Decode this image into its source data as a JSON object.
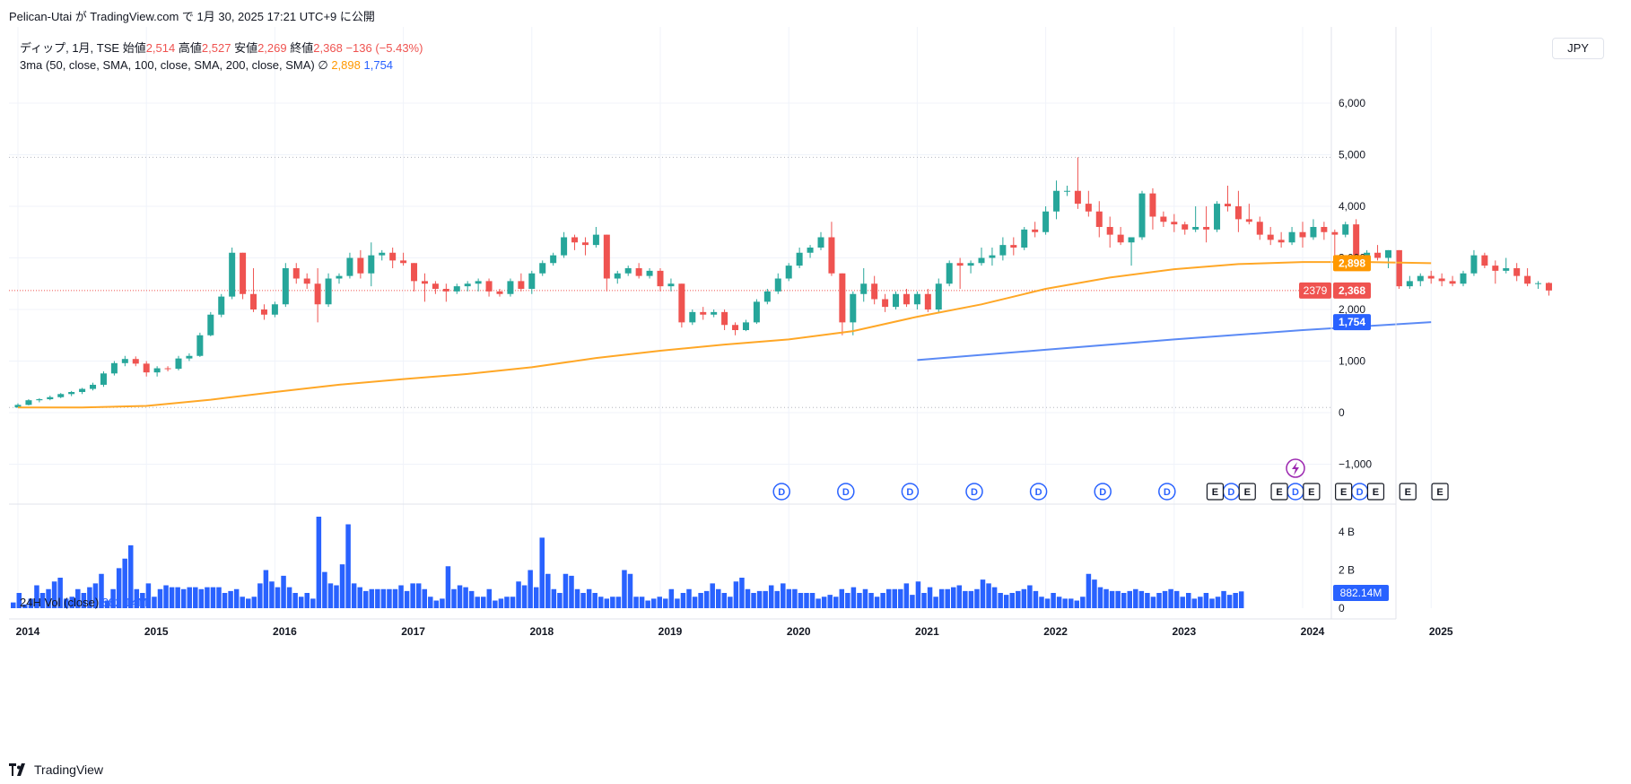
{
  "header": {
    "publish_line": "Pelican-Utai が TradingView.com で 1月 30, 2025 17:21 UTC+9 に公開"
  },
  "legend": {
    "symbol": "ディップ, 1月, TSE",
    "open_label": "始値",
    "open": "2,514",
    "high_label": "高値",
    "high": "2,527",
    "low_label": "安値",
    "low": "2,269",
    "close_label": "終値",
    "close": "2,368",
    "change": "−136 (−5.43%)",
    "ma_label": "3ma (50, close, SMA, 100, close, SMA, 200, close, SMA)",
    "ma_empty": "∅",
    "ma50": "2,898",
    "ma100": "1,754",
    "vol_label": "24H Vol (close)",
    "vol_value": "882.14M"
  },
  "currency": "JPY",
  "footer": {
    "brand": "TradingView"
  },
  "colors": {
    "up": "#26a69a",
    "down": "#ef5350",
    "ma50": "#ffa726",
    "ma100": "#5b8af5",
    "volume": "#2962ff"
  },
  "chart_data": {
    "type": "candlestick",
    "interval": "monthly",
    "start": "2014-01",
    "ohlc": [
      [
        100,
        180,
        95,
        150
      ],
      [
        150,
        260,
        140,
        240
      ],
      [
        240,
        280,
        200,
        260
      ],
      [
        260,
        330,
        240,
        300
      ],
      [
        300,
        380,
        280,
        360
      ],
      [
        360,
        420,
        320,
        400
      ],
      [
        400,
        480,
        360,
        460
      ],
      [
        460,
        580,
        430,
        540
      ],
      [
        540,
        800,
        500,
        760
      ],
      [
        760,
        1000,
        720,
        960
      ],
      [
        960,
        1100,
        900,
        1040
      ],
      [
        1040,
        1090,
        900,
        950
      ],
      [
        950,
        1000,
        700,
        780
      ],
      [
        780,
        900,
        700,
        860
      ],
      [
        860,
        900,
        800,
        850
      ],
      [
        850,
        1100,
        820,
        1050
      ],
      [
        1050,
        1150,
        1000,
        1100
      ],
      [
        1100,
        1550,
        1080,
        1500
      ],
      [
        1500,
        1950,
        1480,
        1900
      ],
      [
        1900,
        2300,
        1850,
        2250
      ],
      [
        2250,
        3200,
        2200,
        3100
      ],
      [
        3100,
        3100,
        2200,
        2300
      ],
      [
        2300,
        2800,
        1950,
        2000
      ],
      [
        2000,
        2100,
        1800,
        1900
      ],
      [
        1900,
        2150,
        1850,
        2100
      ],
      [
        2100,
        2900,
        2050,
        2800
      ],
      [
        2800,
        2900,
        2500,
        2600
      ],
      [
        2600,
        2700,
        2400,
        2500
      ],
      [
        2500,
        2800,
        1750,
        2100
      ],
      [
        2100,
        2700,
        2050,
        2600
      ],
      [
        2600,
        2700,
        2500,
        2650
      ],
      [
        2650,
        3100,
        2600,
        3000
      ],
      [
        3000,
        3150,
        2600,
        2700
      ],
      [
        2700,
        3300,
        2450,
        3050
      ],
      [
        3050,
        3150,
        2950,
        3100
      ],
      [
        3100,
        3200,
        2800,
        2950
      ],
      [
        2950,
        3100,
        2850,
        2900
      ],
      [
        2900,
        2900,
        2350,
        2550
      ],
      [
        2550,
        2700,
        2150,
        2500
      ],
      [
        2500,
        2550,
        2300,
        2400
      ],
      [
        2400,
        2500,
        2150,
        2350
      ],
      [
        2350,
        2500,
        2300,
        2450
      ],
      [
        2450,
        2550,
        2350,
        2500
      ],
      [
        2500,
        2600,
        2350,
        2550
      ],
      [
        2550,
        2600,
        2250,
        2350
      ],
      [
        2350,
        2400,
        2250,
        2300
      ],
      [
        2300,
        2600,
        2250,
        2550
      ],
      [
        2550,
        2700,
        2350,
        2400
      ],
      [
        2400,
        2750,
        2300,
        2700
      ],
      [
        2700,
        2950,
        2650,
        2900
      ],
      [
        2900,
        3100,
        2850,
        3050
      ],
      [
        3050,
        3500,
        3000,
        3400
      ],
      [
        3400,
        3450,
        3150,
        3300
      ],
      [
        3300,
        3400,
        3050,
        3250
      ],
      [
        3250,
        3600,
        3200,
        3450
      ],
      [
        3450,
        3450,
        2350,
        2600
      ],
      [
        2600,
        2750,
        2500,
        2700
      ],
      [
        2700,
        2850,
        2650,
        2800
      ],
      [
        2800,
        2900,
        2600,
        2650
      ],
      [
        2650,
        2800,
        2600,
        2750
      ],
      [
        2750,
        2800,
        2350,
        2450
      ],
      [
        2450,
        2600,
        2350,
        2500
      ],
      [
        2500,
        2500,
        1650,
        1750
      ],
      [
        1750,
        2000,
        1700,
        1950
      ],
      [
        1950,
        2050,
        1800,
        1900
      ],
      [
        1900,
        2000,
        1850,
        1950
      ],
      [
        1950,
        2000,
        1600,
        1700
      ],
      [
        1700,
        1750,
        1500,
        1600
      ],
      [
        1600,
        1800,
        1580,
        1750
      ],
      [
        1750,
        2200,
        1720,
        2150
      ],
      [
        2150,
        2400,
        2100,
        2350
      ],
      [
        2350,
        2700,
        2300,
        2600
      ],
      [
        2600,
        2900,
        2550,
        2850
      ],
      [
        2850,
        3200,
        2800,
        3100
      ],
      [
        3100,
        3250,
        3000,
        3200
      ],
      [
        3200,
        3500,
        3150,
        3400
      ],
      [
        3400,
        3700,
        2650,
        2700
      ],
      [
        2700,
        2700,
        1500,
        1750
      ],
      [
        1750,
        2350,
        1500,
        2300
      ],
      [
        2300,
        2800,
        2150,
        2500
      ],
      [
        2500,
        2650,
        2100,
        2200
      ],
      [
        2200,
        2300,
        1950,
        2050
      ],
      [
        2050,
        2350,
        2000,
        2300
      ],
      [
        2300,
        2400,
        2050,
        2100
      ],
      [
        2100,
        2350,
        2000,
        2300
      ],
      [
        2300,
        2400,
        1950,
        2000
      ],
      [
        2000,
        2600,
        1950,
        2500
      ],
      [
        2500,
        2950,
        2450,
        2900
      ],
      [
        2900,
        3000,
        2400,
        2850
      ],
      [
        2850,
        2950,
        2700,
        2900
      ],
      [
        2900,
        3200,
        2850,
        3000
      ],
      [
        3000,
        3200,
        2850,
        3050
      ],
      [
        3050,
        3400,
        2950,
        3250
      ],
      [
        3250,
        3400,
        3050,
        3200
      ],
      [
        3200,
        3600,
        3150,
        3550
      ],
      [
        3550,
        3700,
        3400,
        3500
      ],
      [
        3500,
        4000,
        3450,
        3900
      ],
      [
        3900,
        4500,
        3750,
        4300
      ],
      [
        4300,
        4400,
        4200,
        4300
      ],
      [
        4300,
        4950,
        3950,
        4050
      ],
      [
        4050,
        4300,
        3800,
        3900
      ],
      [
        3900,
        4100,
        3400,
        3600
      ],
      [
        3600,
        3800,
        3200,
        3450
      ],
      [
        3450,
        3600,
        3250,
        3300
      ],
      [
        3300,
        3400,
        2850,
        3400
      ],
      [
        3400,
        4300,
        3350,
        4250
      ],
      [
        4250,
        4350,
        3550,
        3800
      ],
      [
        3800,
        3900,
        3600,
        3700
      ],
      [
        3700,
        3850,
        3500,
        3650
      ],
      [
        3650,
        3700,
        3450,
        3550
      ],
      [
        3550,
        4000,
        3500,
        3600
      ],
      [
        3600,
        4000,
        3300,
        3550
      ],
      [
        3550,
        4100,
        3500,
        4050
      ],
      [
        4050,
        4400,
        3900,
        4000
      ],
      [
        4000,
        4300,
        3500,
        3750
      ],
      [
        3750,
        4050,
        3650,
        3700
      ],
      [
        3700,
        3800,
        3350,
        3450
      ],
      [
        3450,
        3600,
        3250,
        3350
      ],
      [
        3350,
        3500,
        3200,
        3300
      ],
      [
        3300,
        3600,
        3250,
        3500
      ],
      [
        3500,
        3700,
        3200,
        3400
      ],
      [
        3400,
        3750,
        3350,
        3600
      ],
      [
        3600,
        3700,
        3350,
        3500
      ],
      [
        3500,
        3550,
        3050,
        3450
      ],
      [
        3450,
        3700,
        3400,
        3650
      ],
      [
        3650,
        3750,
        2850,
        2900
      ],
      [
        2900,
        3150,
        2850,
        3100
      ],
      [
        3100,
        3250,
        2950,
        3000
      ],
      [
        3000,
        3150,
        2800,
        3150
      ],
      [
        3150,
        3150,
        2400,
        2450
      ],
      [
        2450,
        2650,
        2400,
        2550
      ],
      [
        2550,
        2700,
        2450,
        2650
      ],
      [
        2650,
        2750,
        2500,
        2600
      ],
      [
        2600,
        2700,
        2450,
        2550
      ],
      [
        2550,
        2650,
        2450,
        2500
      ],
      [
        2500,
        2750,
        2450,
        2700
      ],
      [
        2700,
        3150,
        2650,
        3050
      ],
      [
        3050,
        3100,
        2800,
        2850
      ],
      [
        2850,
        2950,
        2500,
        2750
      ],
      [
        2750,
        3000,
        2700,
        2800
      ],
      [
        2800,
        2900,
        2550,
        2650
      ],
      [
        2650,
        2800,
        2450,
        2500
      ],
      [
        2500,
        2550,
        2400,
        2510
      ],
      [
        2514,
        2527,
        2269,
        2368
      ]
    ],
    "volume_billions": [
      0.3,
      0.8,
      0.2,
      0.5,
      1.2,
      0.8,
      1.0,
      1.4,
      1.6,
      0.5,
      0.6,
      1.0,
      0.8,
      1.1,
      1.3,
      1.8,
      0.4,
      1.0,
      2.1,
      2.6,
      3.3,
      1.0,
      0.8,
      1.3,
      0.6,
      1.0,
      1.2,
      1.1,
      1.1,
      1.0,
      1.1,
      1.1,
      1.0,
      1.1,
      1.1,
      1.1,
      0.8,
      0.9,
      1.0,
      0.6,
      0.5,
      0.6,
      1.3,
      2.0,
      1.4,
      1.1,
      1.7,
      1.1,
      0.8,
      0.6,
      0.8,
      0.5,
      4.8,
      1.9,
      1.3,
      1.2,
      2.3,
      4.4,
      1.3,
      1.1,
      0.9,
      1.0,
      1.0,
      1.0,
      1.0,
      1.0,
      1.2,
      0.9,
      1.3,
      1.3,
      1.0,
      0.6,
      0.4,
      0.5,
      2.2,
      1.0,
      1.2,
      1.1,
      0.9,
      0.6,
      0.6,
      1.0,
      0.4,
      0.5,
      0.6,
      0.6,
      1.4,
      1.2,
      2.0,
      1.1,
      3.7,
      1.8,
      1.0,
      0.8,
      1.8,
      1.7,
      1.0,
      0.8,
      1.0,
      0.8,
      0.6,
      0.5,
      0.6,
      0.6,
      2.0,
      1.8,
      0.6,
      0.6,
      0.4,
      0.5,
      0.6,
      0.5,
      1.0,
      0.5,
      0.8,
      1.0,
      0.6,
      0.8,
      0.9,
      1.3,
      1.0,
      0.8,
      0.6,
      1.4,
      1.6,
      1.0,
      0.8,
      0.9,
      0.9,
      1.2,
      0.9,
      1.3,
      1.0,
      1.0,
      0.8,
      0.8,
      0.8,
      0.5,
      0.6,
      0.7,
      0.6,
      1.0,
      0.8,
      1.1,
      0.8,
      1.0,
      0.8,
      0.6,
      0.8,
      1.0,
      1.0,
      1.0,
      1.3,
      0.7,
      1.4,
      0.8,
      1.1,
      0.6,
      1.0,
      1.0,
      1.1,
      1.2,
      0.9,
      0.9,
      1.0,
      1.5,
      1.3,
      1.1,
      0.8,
      0.7,
      0.8,
      0.9,
      1.0,
      1.2,
      0.9,
      0.6,
      0.5,
      0.8,
      0.6,
      0.5,
      0.5,
      0.4,
      0.6,
      1.8,
      1.5,
      1.1,
      1.0,
      0.9,
      0.9,
      0.8,
      0.9,
      1.0,
      0.9,
      0.8,
      0.6,
      0.8,
      0.9,
      1.0,
      0.9,
      0.6,
      0.8,
      0.5,
      0.6,
      0.8,
      0.5,
      0.6,
      0.9,
      0.7,
      0.8,
      0.88
    ],
    "sma50": [
      [
        2014.0,
        100
      ],
      [
        2014.5,
        100
      ],
      [
        2015.0,
        130
      ],
      [
        2015.5,
        250
      ],
      [
        2016.0,
        400
      ],
      [
        2016.5,
        540
      ],
      [
        2017.0,
        650
      ],
      [
        2017.5,
        750
      ],
      [
        2018.0,
        880
      ],
      [
        2018.5,
        1060
      ],
      [
        2019.0,
        1200
      ],
      [
        2019.5,
        1320
      ],
      [
        2020.0,
        1420
      ],
      [
        2020.5,
        1580
      ],
      [
        2021.0,
        1860
      ],
      [
        2021.5,
        2100
      ],
      [
        2022.0,
        2400
      ],
      [
        2022.5,
        2620
      ],
      [
        2023.0,
        2780
      ],
      [
        2023.5,
        2880
      ],
      [
        2024.0,
        2920
      ],
      [
        2024.5,
        2920
      ],
      [
        2025.0,
        2898
      ]
    ],
    "sma100": [
      [
        2021.0,
        1020
      ],
      [
        2022.0,
        1220
      ],
      [
        2023.0,
        1420
      ],
      [
        2024.0,
        1600
      ],
      [
        2025.0,
        1754
      ]
    ],
    "y_ticks": [
      "6,000",
      "5,000",
      "4,000",
      "3,000",
      "2,000",
      "1,000",
      "0",
      "−1,000"
    ],
    "y_range": [
      -1700,
      7500
    ],
    "volume_ticks": [
      "4 B",
      "2 B",
      "0"
    ],
    "x_ticks": [
      "2014",
      "2015",
      "2016",
      "2017",
      "2018",
      "2019",
      "2020",
      "2021",
      "2022",
      "2023",
      "2024",
      "2025"
    ],
    "price_tags": {
      "ma50": "2,898",
      "close": "2,368",
      "ma100": "1,754",
      "countdown": "2379",
      "volume": "882.14M"
    },
    "dotted_levels": [
      4950,
      100,
      2368
    ],
    "events": {
      "dividend_years": [
        2020.0,
        2020.5,
        2021.0,
        2021.5,
        2022.0,
        2022.5,
        2023.0,
        2023.5,
        2024.0,
        2024.5
      ],
      "dividend_label": "D",
      "earnings_years": [
        2023.2,
        2023.45,
        2023.7,
        2023.95,
        2024.2,
        2024.45,
        2024.7,
        2024.95
      ],
      "earnings_label": "E"
    }
  }
}
